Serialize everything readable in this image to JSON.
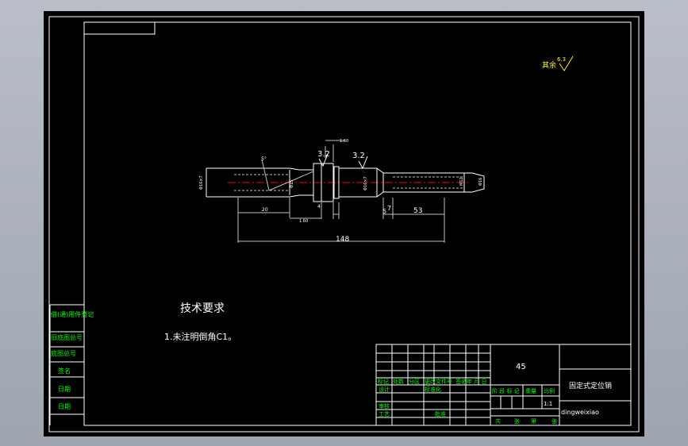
{
  "drawing": {
    "surface_finish_note": {
      "label": "其余",
      "value": "6.3"
    },
    "roughness": [
      "3.2",
      "3.2"
    ],
    "dims": {
      "overall": "148",
      "right_len": "53",
      "d7": "7",
      "d5": "5",
      "left_len": "20",
      "top_small": "1.60",
      "mid_small": "1.60",
      "d4": "4",
      "dia_left": "Φ16×7",
      "dia_left_inner": "Φ15",
      "dia_mid": "Φ16×7",
      "dia_right": "Φ16",
      "dia_right_inner": "M12",
      "angle_left": "5°"
    },
    "tech_requirements_title": "技术要求",
    "tech_requirements_item": "1.未注明倒角C1。"
  },
  "left_strip": {
    "items": [
      "借(通)用件登记",
      "旧底图总号",
      "底图总号",
      "签名",
      "日期",
      "日期"
    ]
  },
  "title_block": {
    "material": "45",
    "part_name": "固定式定位销",
    "drawing_code": "dingweixiao",
    "row_labels": [
      "标记",
      "处数",
      "分区",
      "更改文件号",
      "签名",
      "年 月 日"
    ],
    "design": "设计",
    "standardize": "标准化",
    "audit": "审核",
    "craft": "工艺",
    "approve": "批准",
    "stage_header": [
      "阶 段 标 记",
      "重量",
      "比例"
    ],
    "scale": "1:1",
    "sheets": [
      "共",
      "张",
      "第",
      "张"
    ]
  },
  "colors": {
    "background": "#000000",
    "line": "#ffffff",
    "text_yellow": "#ffff00",
    "text_green": "#00ff00",
    "centerline": "#ff0000",
    "gray": "#c0c0c0"
  }
}
